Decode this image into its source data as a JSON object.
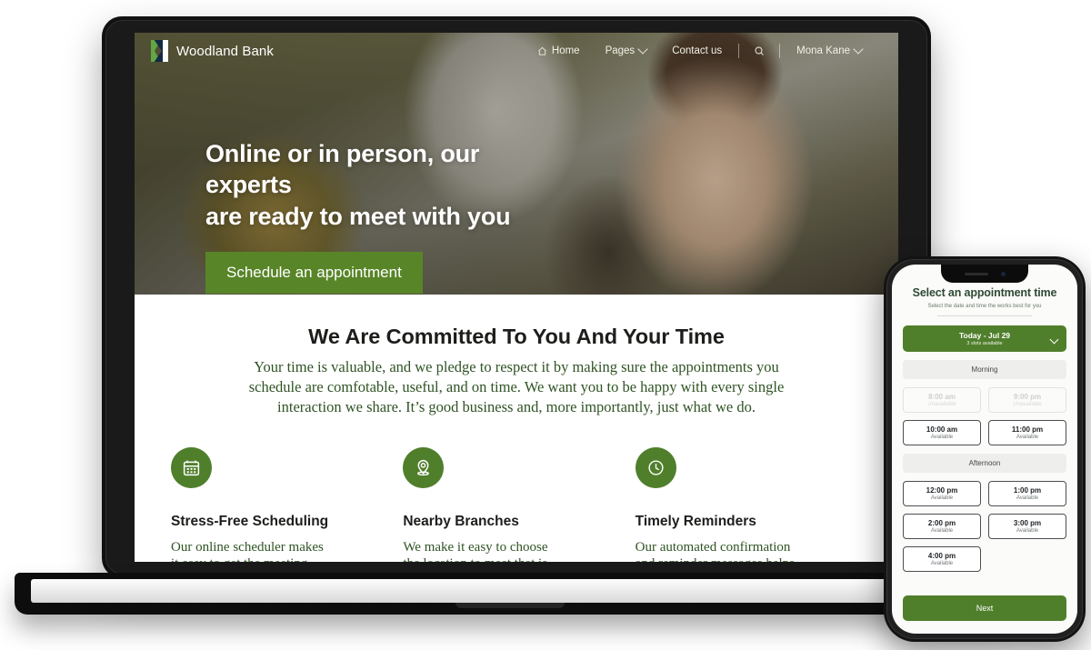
{
  "theme": {
    "brand_green": "#588527",
    "icon_green": "#507f2c",
    "body_green": "#2f5324",
    "heading_dark": "#1d1d1b"
  },
  "laptop": {
    "nav": {
      "brand": "Woodland Bank",
      "links": [
        {
          "label": "Home",
          "icon": "home-icon",
          "has_chevron": false
        },
        {
          "label": "Pages",
          "icon": "",
          "has_chevron": true
        },
        {
          "label": "Contact us",
          "icon": "",
          "has_chevron": false
        }
      ],
      "search_icon": "search-icon",
      "account": {
        "label": "Mona Kane",
        "has_chevron": true
      }
    },
    "hero": {
      "title_line1": "Online or in person, our experts",
      "title_line2": "are ready to meet with you",
      "cta_label": "Schedule an appointment"
    },
    "committed": {
      "heading": "We Are Committed To You And Your Time",
      "body": "Your time is valuable, and we pledge to respect it by making sure the appointments you schedule are comfotable, useful, and on time. We want you to be happy with every single interaction we share. It’s good business and, more importantly, just what we do."
    },
    "features": [
      {
        "icon": "calendar-icon",
        "title": "Stress-Free Scheduling",
        "body": "Our online scheduler makes it easy to get the meeting time"
      },
      {
        "icon": "map-pin-icon",
        "title": "Nearby Branches",
        "body": "We make it easy to choose the location to meet that is"
      },
      {
        "icon": "clock-icon",
        "title": "Timely Reminders",
        "body": "Our automated confirmation and reminder messages helps"
      }
    ]
  },
  "phone": {
    "title": "Select an appointment time",
    "subtitle": "Select the date and time the works best for you",
    "date_selector": {
      "label": "Today - Jul 29",
      "sublabel": "3 slots available",
      "chevron": "chevron-down-icon"
    },
    "sections": [
      {
        "heading": "Morning",
        "slots": [
          {
            "time": "8:00 am",
            "status": "Unavailable",
            "available": false
          },
          {
            "time": "9:00 pm",
            "status": "Unavailable",
            "available": false
          },
          {
            "time": "10:00 am",
            "status": "Available",
            "available": true
          },
          {
            "time": "11:00 pm",
            "status": "Available",
            "available": true
          }
        ]
      },
      {
        "heading": "Afternoon",
        "slots": [
          {
            "time": "12:00 pm",
            "status": "Available",
            "available": true
          },
          {
            "time": "1:00 pm",
            "status": "Available",
            "available": true
          },
          {
            "time": "2:00 pm",
            "status": "Available",
            "available": true
          },
          {
            "time": "3:00 pm",
            "status": "Available",
            "available": true
          },
          {
            "time": "4:00 pm",
            "status": "Available",
            "available": true
          }
        ]
      }
    ],
    "next_label": "Next"
  }
}
